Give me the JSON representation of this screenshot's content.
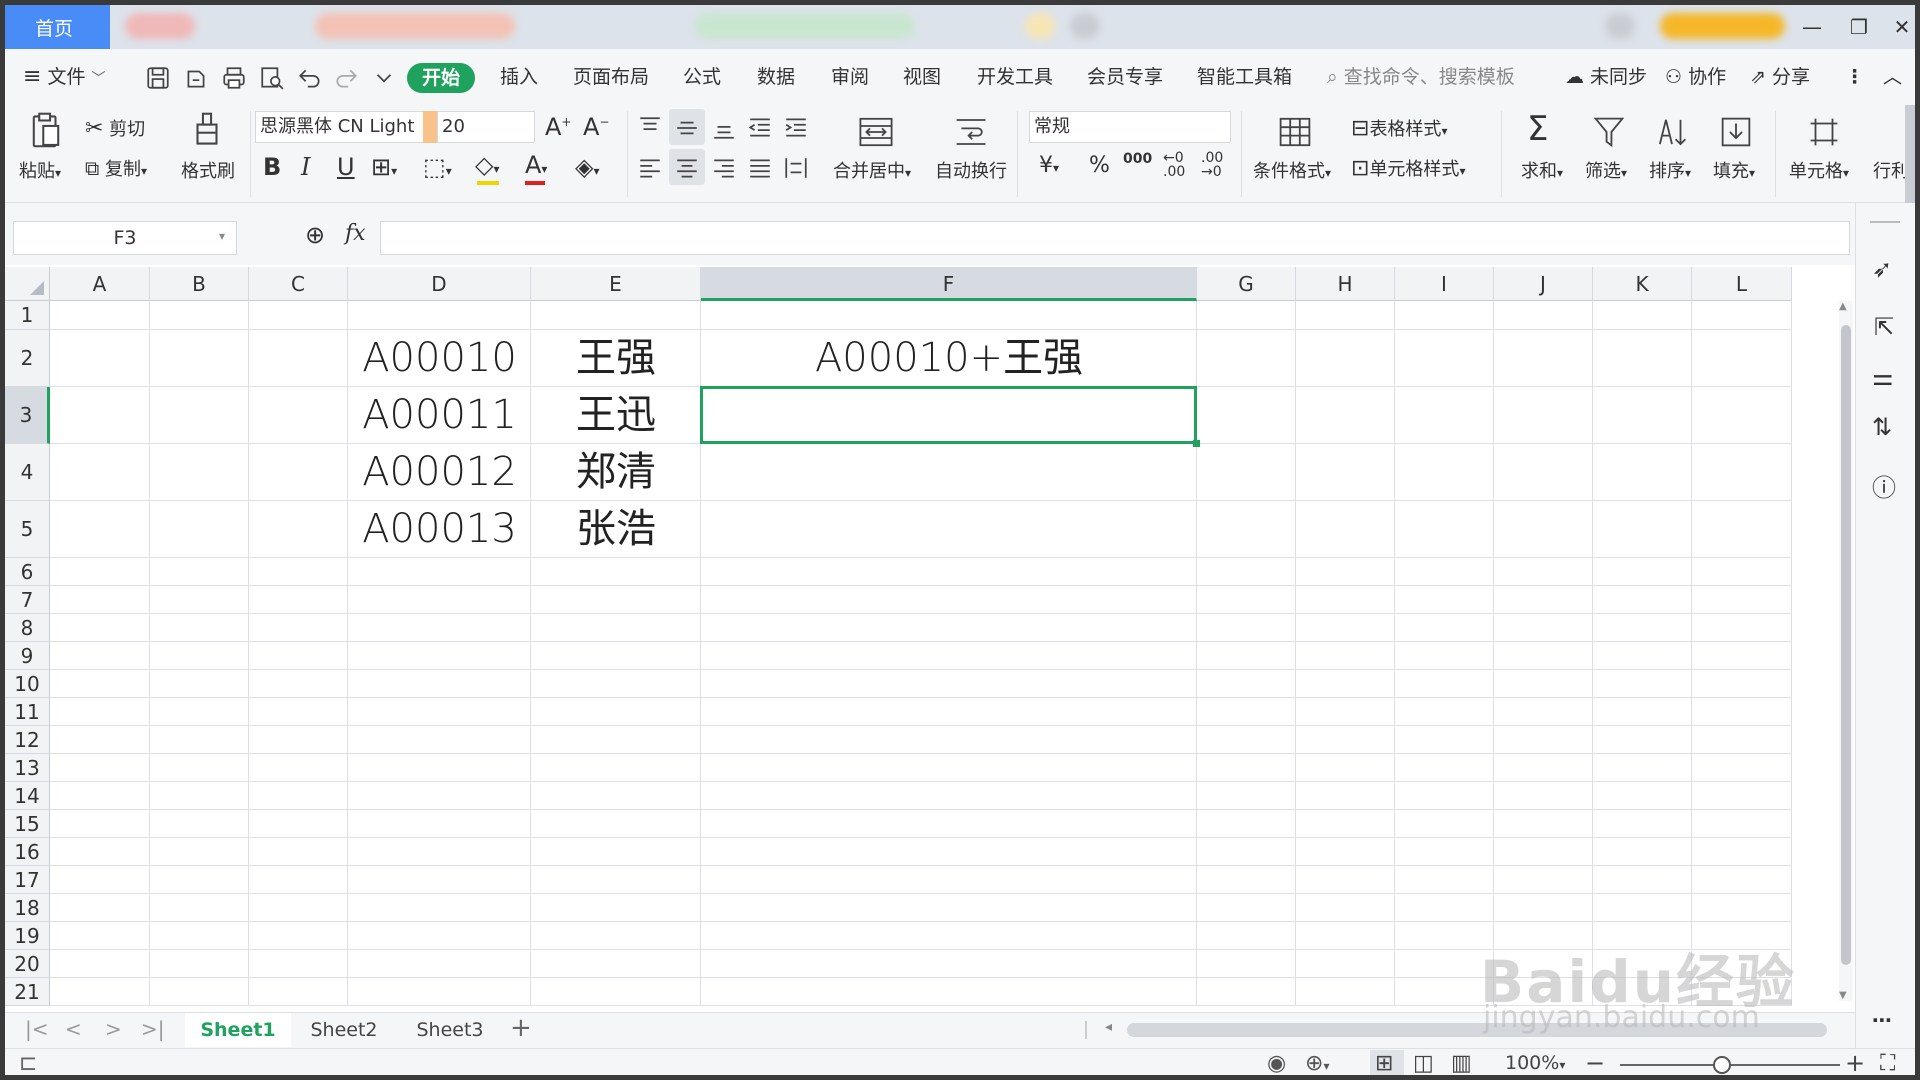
{
  "titlebar": {
    "home_tab": "首页",
    "win_min": "—",
    "win_restore": "❐",
    "win_close": "✕"
  },
  "menu": {
    "file": "文件",
    "items": [
      "开始",
      "插入",
      "页面布局",
      "公式",
      "数据",
      "审阅",
      "视图",
      "开发工具",
      "会员专享",
      "智能工具箱"
    ],
    "search_placeholder": "查找命令、搜索模板",
    "unsynced": "未同步",
    "collaborate": "协作",
    "share": "分享"
  },
  "ribbon": {
    "cut": "剪切",
    "paste": "粘贴",
    "copy": "复制",
    "format_painter": "格式刷",
    "font_name": "思源黑体 CN Light",
    "font_size": "20",
    "merge_center": "合并居中",
    "wrap_text": "自动换行",
    "number_format": "常规",
    "table_style": "表格样式",
    "conditional_format": "条件格式",
    "cell_style": "单元格样式",
    "sum": "求和",
    "filter": "筛选",
    "sort": "排序",
    "fill": "填充",
    "cell": "单元格",
    "row_col": "行利",
    "bold": "B",
    "italic": "I",
    "underline": "U",
    "percent": "%",
    "thousands": "000",
    "currency": "¥"
  },
  "formula_bar": {
    "cell_ref": "F3",
    "fx": "fx",
    "formula": ""
  },
  "columns": [
    "A",
    "B",
    "C",
    "D",
    "E",
    "F",
    "G",
    "H",
    "I",
    "J",
    "K",
    "L"
  ],
  "rows": [
    "1",
    "2",
    "3",
    "4",
    "5",
    "6",
    "7",
    "8",
    "9",
    "10",
    "11",
    "12",
    "13",
    "14",
    "15",
    "16",
    "17",
    "18",
    "19",
    "20",
    "21"
  ],
  "cells": {
    "D2": "A00010",
    "E2": "王强",
    "F2": "A00010+王强",
    "D3": "A00011",
    "E3": "王迅",
    "D4": "A00012",
    "E4": "郑清",
    "D5": "A00013",
    "E5": "张浩"
  },
  "selected_cell": "F3",
  "sheets": [
    "Sheet1",
    "Sheet2",
    "Sheet3"
  ],
  "active_sheet": "Sheet1",
  "status": {
    "zoom": "100%"
  },
  "colors": {
    "accent": "#1fa25d",
    "home_tab": "#4a8cf7"
  },
  "watermark": {
    "brand": "Baidu经验",
    "url": "jingyan.baidu.com"
  }
}
